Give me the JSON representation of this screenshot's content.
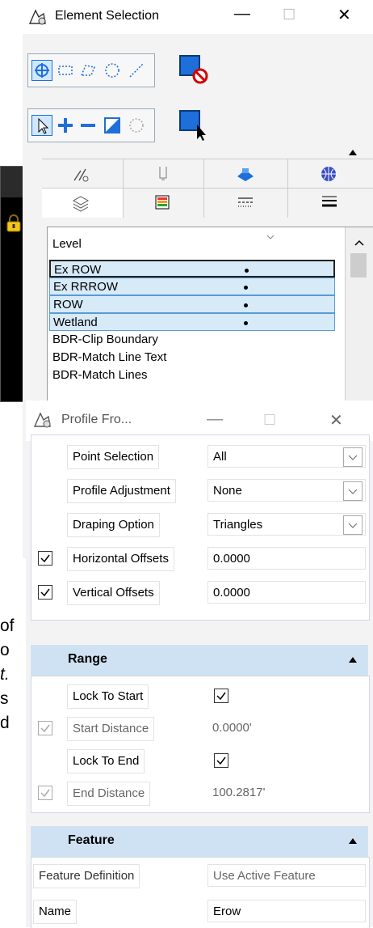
{
  "element_selection": {
    "title": "Element Selection",
    "layers_list": {
      "header": "Level",
      "rows": [
        {
          "name": "Ex ROW",
          "dot": true,
          "highlight": true
        },
        {
          "name": "Ex RRROW",
          "dot": true,
          "highlight": true
        },
        {
          "name": "ROW",
          "dot": true,
          "highlight": true
        },
        {
          "name": "Wetland",
          "dot": true,
          "highlight": true
        },
        {
          "name": "BDR-Clip Boundary",
          "dot": false,
          "highlight": false
        },
        {
          "name": "BDR-Match Line Text",
          "dot": false,
          "highlight": false
        },
        {
          "name": "BDR-Match Lines",
          "dot": false,
          "highlight": false
        }
      ]
    }
  },
  "profile_window": {
    "title": "Profile Fro...",
    "general": {
      "point_selection": {
        "label": "Point Selection",
        "value": "All"
      },
      "profile_adjustment": {
        "label": "Profile Adjustment",
        "value": "None"
      },
      "draping_option": {
        "label": "Draping Option",
        "value": "Triangles"
      },
      "horizontal_offsets": {
        "label": "Horizontal Offsets",
        "value": "0.0000",
        "checked": true
      },
      "vertical_offsets": {
        "label": "Vertical Offsets",
        "value": "0.0000",
        "checked": true
      }
    },
    "range": {
      "header": "Range",
      "lock_to_start": {
        "label": "Lock To Start",
        "checked": true
      },
      "start_distance": {
        "label": "Start Distance",
        "value": "0.0000'",
        "checked": true
      },
      "lock_to_end": {
        "label": "Lock To End",
        "checked": true
      },
      "end_distance": {
        "label": "End Distance",
        "value": "100.2817'",
        "checked": true
      }
    },
    "feature": {
      "header": "Feature",
      "feature_definition": {
        "label": "Feature Definition",
        "value": "Use Active Feature"
      },
      "name": {
        "label": "Name",
        "value": "Erow"
      }
    }
  },
  "background_doc": {
    "lines": [
      "of",
      "o",
      "t.",
      "s",
      "d"
    ]
  },
  "colors": {
    "highlight_row": "#d7eaf8",
    "section_header": "#cfe2f3",
    "tool_blue": "#1e6fd9",
    "no_red": "#d40000"
  }
}
